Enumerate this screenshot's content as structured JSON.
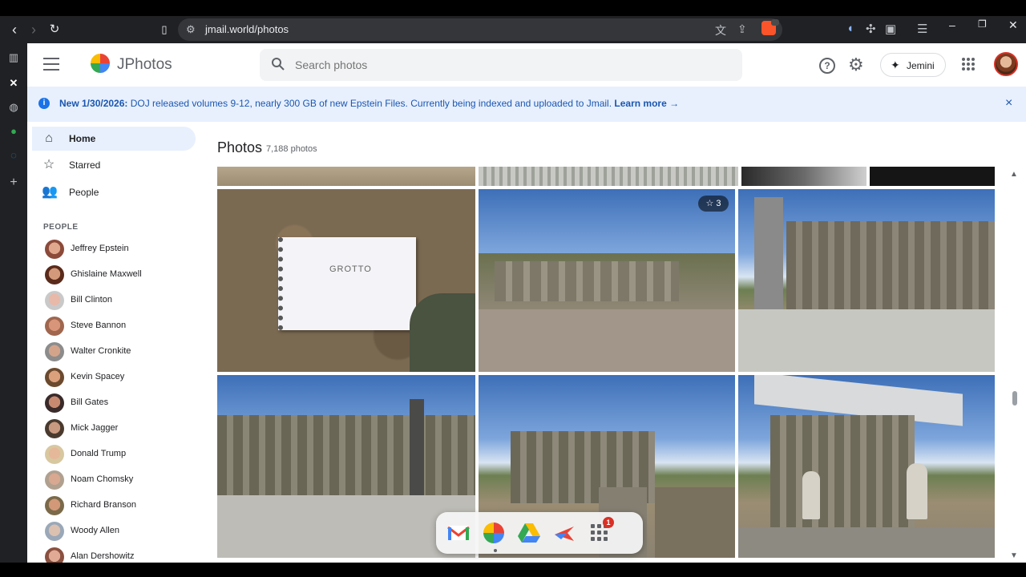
{
  "browser": {
    "url": "jmail.world/photos"
  },
  "app": {
    "brand": "JPhotos",
    "search_placeholder": "Search photos",
    "jemini_label": "Jemini"
  },
  "banner": {
    "bold": "New 1/30/2026:",
    "text": " DOJ released volumes 9-12, nearly 300 GB of new Epstein Files. Currently being indexed and uploaded to Jmail.",
    "link": "Learn more →",
    "close": "×"
  },
  "sidebar": {
    "nav": [
      {
        "label": "Home",
        "icon": "home-icon"
      },
      {
        "label": "Starred",
        "icon": "star-icon"
      },
      {
        "label": "People",
        "icon": "people-icon"
      }
    ],
    "people_heading": "PEOPLE",
    "people": [
      "Jeffrey Epstein",
      "Ghislaine Maxwell",
      "Bill Clinton",
      "Steve Bannon",
      "Walter Cronkite",
      "Kevin Spacey",
      "Bill Gates",
      "Mick Jagger",
      "Donald Trump",
      "Noam Chomsky",
      "Richard Branson",
      "Woody Allen",
      "Alan Dershowitz"
    ]
  },
  "main": {
    "title": "Photos",
    "count": "7,188 photos",
    "starred_badge": "3",
    "note_text": "GROTTO"
  },
  "dock": {
    "apps": [
      "gmail-icon",
      "jphotos-icon",
      "drive-icon",
      "flights-icon",
      "apps-grid-icon"
    ],
    "badge": "1"
  }
}
